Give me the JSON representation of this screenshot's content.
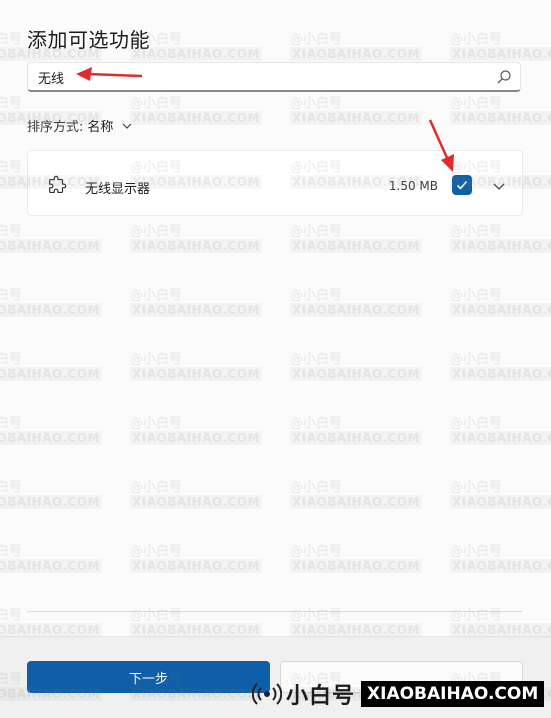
{
  "dialog": {
    "title": "添加可选功能",
    "search": {
      "value": "无线",
      "placeholder": ""
    },
    "sort": {
      "label": "排序方式:",
      "value": "名称"
    },
    "features": [
      {
        "name": "无线显示器",
        "size": "1.50 MB",
        "checked": true
      }
    ],
    "buttons": {
      "next": "下一步",
      "cancel": ""
    }
  },
  "watermark": {
    "cn": "@小白号",
    "en": "XIAOBAIHAO.COM"
  },
  "brand": {
    "cn": "小白号",
    "en": "XIAOBAIHAO.COM"
  },
  "colors": {
    "accent": "#0f5fa8",
    "arrow": "#e02b2b"
  },
  "icons": {
    "search": "search-icon",
    "feature": "puzzle-icon",
    "expand": "chevron-down-icon"
  }
}
